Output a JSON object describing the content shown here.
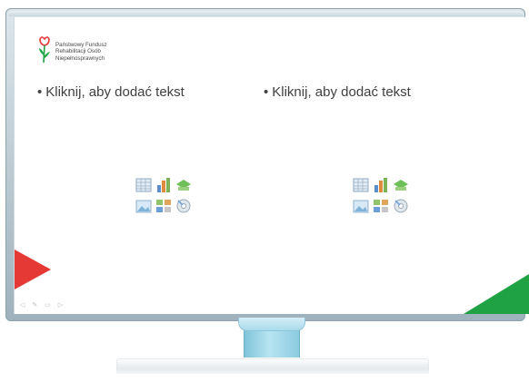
{
  "logo": {
    "lines": [
      "Państwowy Fundusz",
      "Rehabilitacji Osób",
      "Niepełnosprawnych"
    ]
  },
  "slide": {
    "left_placeholder": "Kliknij, aby dodać tekst",
    "right_placeholder": "Kliknij, aby dodać tekst",
    "bullet": "•"
  },
  "colors": {
    "red_accent": "#e53935",
    "green_accent": "#1fa244",
    "stand": "#a9dbeb"
  },
  "icons": [
    "table-icon",
    "chart-icon",
    "smartart-icon",
    "picture-icon",
    "clipart-icon",
    "media-icon"
  ]
}
